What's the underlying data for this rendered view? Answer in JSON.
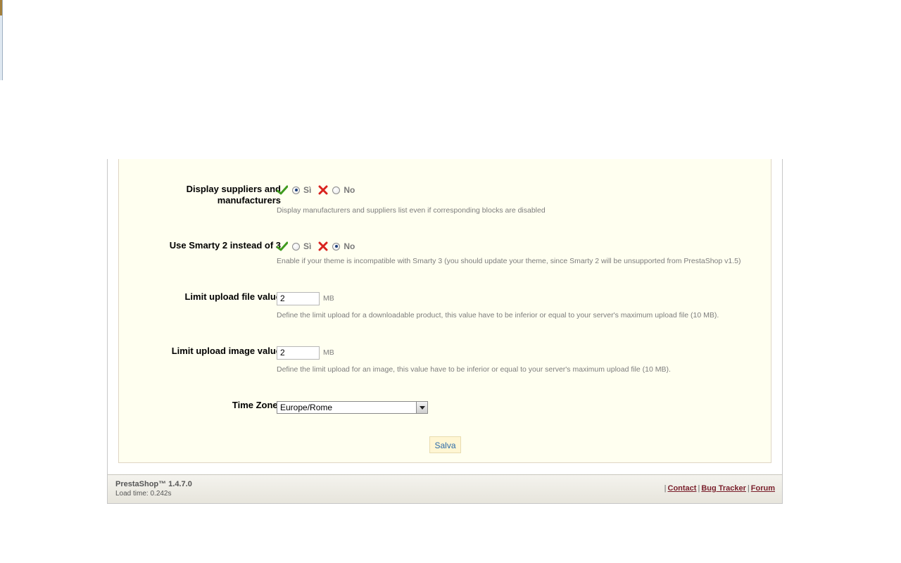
{
  "settings": {
    "display_suppliers": {
      "label": "Display suppliers and manufacturers",
      "label_line1": "Display suppliers and",
      "label_line2": "manufacturers",
      "option_yes": "Sì",
      "option_no": "No",
      "selected": "yes",
      "hint": "Display manufacturers and suppliers list even if corresponding blocks are disabled"
    },
    "use_smarty2": {
      "label": "Use Smarty 2 instead of 3",
      "option_yes": "Sì",
      "option_no": "No",
      "selected": "no",
      "hint": "Enable if your theme is incompatible with Smarty 3 (you should update your theme, since Smarty 2 will be unsupported from PrestaShop v1.5)"
    },
    "limit_upload_file": {
      "label": "Limit upload file value",
      "value": "2",
      "unit": "MB",
      "hint": "Define the limit upload for a downloadable product, this value have to be inferior or equal to your server's maximum upload file (10 MB)."
    },
    "limit_upload_image": {
      "label": "Limit upload image value",
      "value": "2",
      "unit": "MB",
      "hint": "Define the limit upload for an image, this value have to be inferior or equal to your server's maximum upload file (10 MB)."
    },
    "time_zone": {
      "label": "Time Zone:",
      "selected": "Europe/Rome"
    },
    "save_label": "Salva"
  },
  "footer": {
    "brand": "PrestaShop™ 1.4.7.0",
    "load_time": "Load time: 0.242s",
    "links": [
      "Contact",
      "Bug Tracker",
      "Forum"
    ],
    "separator": "|"
  },
  "icons": {
    "yes": "check-icon",
    "no": "cross-icon"
  },
  "colors": {
    "panel_bg": "#fffff0",
    "link": "#7a1f2b",
    "save_text": "#2b6aa8"
  }
}
